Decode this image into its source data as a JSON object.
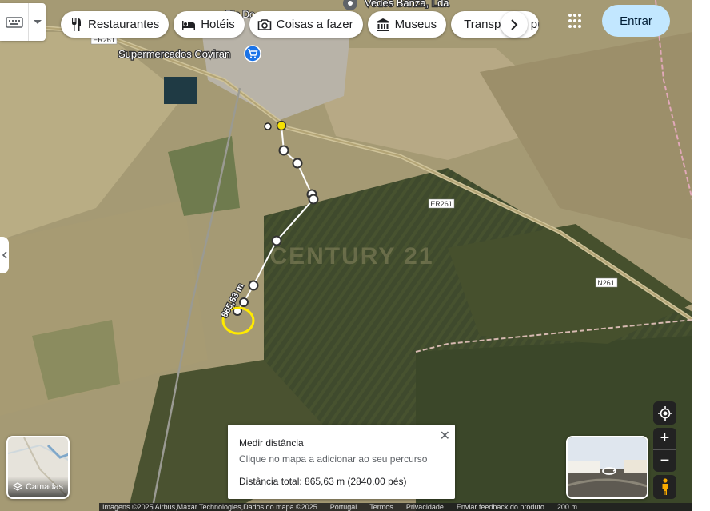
{
  "map": {
    "places": {
      "supermarket": "Supermercados Coviran",
      "business": "Vedes Banza, Lda",
      "town_partial": "Rio Do"
    },
    "roads": {
      "er261_a": "ER261",
      "er261_b": "ER261",
      "n261": "N261"
    },
    "watermark": "CENTURY 21",
    "measure_label": "865,63 m",
    "colors": {
      "route_line": "#ffffff",
      "start_point": "#f5e003",
      "cursor_ring": "#ffea00",
      "pin": "#1a73e8"
    }
  },
  "topbar": {
    "chips": [
      {
        "label": "Restaurantes",
        "icon": "fork-knife-icon"
      },
      {
        "label": "Hotéis",
        "icon": "bed-icon"
      },
      {
        "label": "Coisas a fazer",
        "icon": "camera-icon"
      },
      {
        "label": "Museus",
        "icon": "museum-icon"
      },
      {
        "label": "Transportes públicos",
        "icon": "train-icon"
      }
    ],
    "signin": "Entrar"
  },
  "layers": {
    "label": "Camadas"
  },
  "measure": {
    "title": "Medir distância",
    "hint": "Clique no mapa a adicionar ao seu percurso",
    "total": "Distância total: 865,63 m (2840,00 pés)"
  },
  "footer": {
    "attribution": "Imagens ©2025 Airbus,Maxar Technologies,Dados do mapa ©2025",
    "links": [
      "Portugal",
      "Termos",
      "Privacidade",
      "Enviar feedback do produto"
    ],
    "scale": "200 m"
  }
}
